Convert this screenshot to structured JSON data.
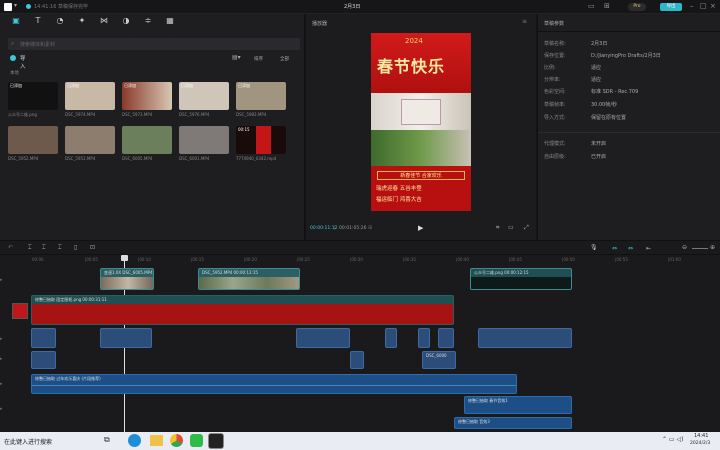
{
  "titlebar": {
    "left_text": "14:41:16 草稿保存完毕",
    "project_name": "2月3日",
    "export_label": "导出",
    "pro_label": "Pro"
  },
  "toolbar": {
    "items": [
      {
        "label": "媒体",
        "icon": "media-icon"
      },
      {
        "label": "文本",
        "icon": "text-icon"
      },
      {
        "label": "贴纸",
        "icon": "sticker-icon"
      },
      {
        "label": "特效",
        "icon": "effects-icon"
      },
      {
        "label": "转场",
        "icon": "transition-icon"
      },
      {
        "label": "滤镜",
        "icon": "filter-icon"
      },
      {
        "label": "调节",
        "icon": "adjust-icon"
      },
      {
        "label": "模板",
        "icon": "template-icon"
      }
    ]
  },
  "media": {
    "search_placeholder": "搜索媒体和素材",
    "import_label": "导入",
    "local_label": "本地",
    "sort_label": "排序",
    "all_label": "全部",
    "clips": [
      {
        "label": "已添加",
        "name": "公众号二维.png",
        "color": "#111"
      },
      {
        "label": "已添加",
        "name": "DSC_5974.MP4",
        "color": "#c7b9a6"
      },
      {
        "label": "已添加",
        "name": "DSC_5973.MP4",
        "color": "#b06a5a"
      },
      {
        "label": "已添加",
        "name": "DSC_5976.MP4",
        "color": "#cfc6b9"
      },
      {
        "label": "已添加",
        "name": "DSC_5983.MP4",
        "color": "#a19580"
      },
      {
        "label": "",
        "name": "DSC_5952.MP4",
        "color": "#6e5a4c"
      },
      {
        "label": "",
        "name": "DSC_5953.MP4",
        "color": "#8d7d6e"
      },
      {
        "label": "",
        "name": "DSC_6005.MP4",
        "color": "#6b7f5c"
      },
      {
        "label": "",
        "name": "DSC_6001.MP4",
        "color": "#7f7a78"
      },
      {
        "label": "00:15",
        "name": "7774940_0342.mp4",
        "color": "#1a0b0b"
      }
    ]
  },
  "player": {
    "title": "播放器",
    "current_time": "00:00:11:12",
    "total_time": "00:01:05:26",
    "poster_title": "春节快乐",
    "poster_banner": "新春佳节 合家欢乐",
    "poster_lines": [
      "瑞虎迎春 五谷丰登",
      "福运临门 鸿喜大吉"
    ]
  },
  "props": {
    "title": "草稿参数",
    "rows": [
      {
        "k": "草稿名称:",
        "v": "2月3日"
      },
      {
        "k": "保存位置:",
        "v": "D:/JianyingPro Drafts/2月3日"
      },
      {
        "k": "比例:",
        "v": "适应"
      },
      {
        "k": "分辨率:",
        "v": "适应"
      },
      {
        "k": "色彩空间:",
        "v": "标准 SDR - Rec.709"
      },
      {
        "k": "草稿帧率:",
        "v": "30.00帧/秒"
      },
      {
        "k": "导入方式:",
        "v": "保留在原有位置"
      },
      {
        "k": "代理模式:",
        "v": "未开启"
      },
      {
        "k": "自由层级:",
        "v": "已开启"
      }
    ]
  },
  "timeline": {
    "ruler": [
      "00:00",
      "|00:05",
      "|00:10",
      "|00:15",
      "|00:20",
      "|00:25",
      "|00:30",
      "|00:35",
      "|00:40",
      "|00:45",
      "|00:50",
      "|00:55",
      "|01:00"
    ],
    "clip_labels": {
      "video1": "变速1.0X  DSC_6005.MP4",
      "video2": "DSC_5952.MP4  00:00:12:15",
      "video3": "公众号二维.png  00:00:12:15",
      "sticker": "修整已抽取  固定图框.png  00:00:31:11",
      "audio_main": "修整已抽取  过年欢乐喜庆 (片段推荐)",
      "audio_b": "修整已抽取  春节音效1",
      "audio_c": "修整已抽取  音效3",
      "small_a": "DSC_6000"
    }
  },
  "taskbar": {
    "search_text": "在此键入进行搜索",
    "time": "14:41",
    "date": "2024/2/3"
  }
}
